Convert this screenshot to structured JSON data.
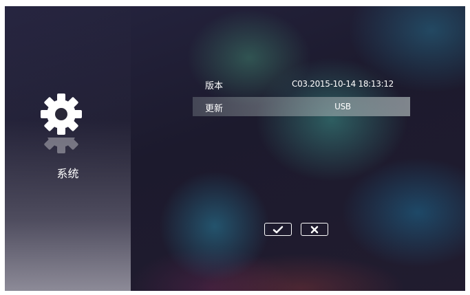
{
  "sidebar": {
    "icon": "gear-icon",
    "label": "系统"
  },
  "settings": {
    "rows": [
      {
        "label": "版本",
        "value": "C03.2015-10-14 18:13:12"
      },
      {
        "label": "更新",
        "value": "USB"
      }
    ],
    "selected_index": 1
  },
  "actions": {
    "confirm_icon": "check-icon",
    "cancel_icon": "x-icon"
  },
  "colors": {
    "text": "#ffffff",
    "highlight": "#aab4b6"
  }
}
